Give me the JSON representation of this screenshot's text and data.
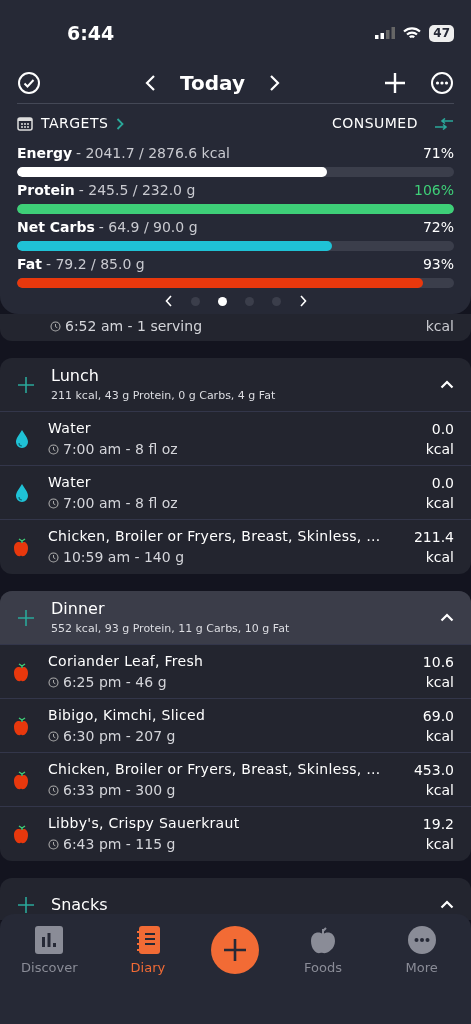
{
  "status_bar": {
    "time": "6:44",
    "battery": "47"
  },
  "header": {
    "title": "Today",
    "targets_label": "TARGETS",
    "consumed_label": "CONSUMED"
  },
  "nutrients": [
    {
      "name": "Energy",
      "amount": "- 2041.7 / 2876.6 kcal",
      "percent": "71%",
      "level": 0.71,
      "color": "#ffffff",
      "over_target": false
    },
    {
      "name": "Protein",
      "amount": "- 245.5 / 232.0 g",
      "percent": "106%",
      "level": 1,
      "color": "#3ecf78",
      "over_target": true
    },
    {
      "name": "Net Carbs",
      "amount": "- 64.9 / 90.0 g",
      "percent": "72%",
      "level": 0.72,
      "color": "#1fc2d6",
      "over_target": false
    },
    {
      "name": "Fat",
      "amount": "- 79.2 / 85.0 g",
      "percent": "93%",
      "level": 0.93,
      "color": "#e8380d",
      "over_target": false
    }
  ],
  "pager": {
    "dots": [
      {
        "selected": false
      },
      {
        "selected": true
      },
      {
        "selected": false
      },
      {
        "selected": false
      }
    ]
  },
  "partial_entry": {
    "detail": "6:52 am - 1 serving",
    "unit": "kcal"
  },
  "meals": [
    {
      "name": "Lunch",
      "summary": "211 kcal, 43 g Protein, 0 g Carbs, 4 g Fat",
      "highlighted": false,
      "entries": [
        {
          "kind": "water",
          "name": "Water",
          "detail": "7:00 am - 8 fl oz",
          "calories": "0.0",
          "unit": "kcal"
        },
        {
          "kind": "water",
          "name": "Water",
          "detail": "7:00 am - 8 fl oz",
          "calories": "0.0",
          "unit": "kcal"
        },
        {
          "kind": "food",
          "name": "Chicken, Broiler or Fryers, Breast, Skinless, …",
          "detail": "10:59 am - 140 g",
          "calories": "211.4",
          "unit": "kcal"
        }
      ]
    },
    {
      "name": "Dinner",
      "summary": "552 kcal, 93 g Protein, 11 g Carbs, 10 g Fat",
      "highlighted": true,
      "entries": [
        {
          "kind": "food",
          "name": "Coriander Leaf, Fresh",
          "detail": "6:25 pm - 46 g",
          "calories": "10.6",
          "unit": "kcal"
        },
        {
          "kind": "food",
          "name": "Bibigo, Kimchi, Sliced",
          "detail": "6:30 pm - 207 g",
          "calories": "69.0",
          "unit": "kcal"
        },
        {
          "kind": "food",
          "name": "Chicken, Broiler or Fryers, Breast, Skinless, …",
          "detail": "6:33 pm - 300 g",
          "calories": "453.0",
          "unit": "kcal"
        },
        {
          "kind": "food",
          "name": "Libby's, Crispy Sauerkraut",
          "detail": "6:43 pm - 115 g",
          "calories": "19.2",
          "unit": "kcal"
        }
      ]
    },
    {
      "name": "Snacks",
      "highlighted": false
    }
  ],
  "tab_bar": [
    {
      "kind": "discover",
      "label": "Discover",
      "selected": false
    },
    {
      "kind": "diary",
      "label": "Diary",
      "selected": true
    },
    {
      "kind": "add"
    },
    {
      "kind": "foods",
      "label": "Foods",
      "selected": false
    },
    {
      "kind": "more",
      "label": "More",
      "selected": false
    }
  ]
}
